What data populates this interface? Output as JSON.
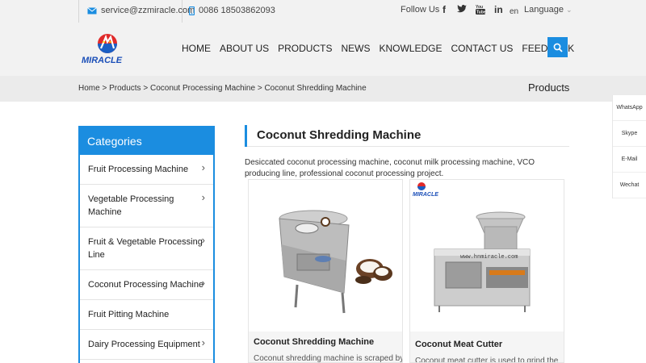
{
  "topbar": {
    "email": "service@zzmiracle.com",
    "phone": "0086 18503862093",
    "follow_label": "Follow Us",
    "social_icons": [
      "facebook-icon",
      "twitter-icon",
      "youtube-icon",
      "linkedin-icon"
    ],
    "lang_code": "en",
    "language_label": "Language"
  },
  "logo": {
    "text": "MIRACLE"
  },
  "nav": {
    "items": [
      "HOME",
      "ABOUT US",
      "PRODUCTS",
      "NEWS",
      "KNOWLEDGE",
      "CONTACT US",
      "FEEDBACK"
    ]
  },
  "breadcrumb": {
    "items": [
      "Home",
      "Products",
      "Coconut Processing Machine",
      "Coconut Shredding Machine"
    ],
    "separator": ">",
    "section_title": "Products"
  },
  "sidebar": {
    "heading": "Categories",
    "items": [
      {
        "label": "Fruit Processing Machine",
        "has_arrow": true
      },
      {
        "label": "Vegetable Processing Machine",
        "has_arrow": true
      },
      {
        "label": "Fruit & Vegetable Processing Line",
        "has_arrow": true
      },
      {
        "label": "Coconut Processing Machine",
        "has_arrow": true
      },
      {
        "label": "Fruit Pitting Machine",
        "has_arrow": false
      },
      {
        "label": "Dairy Processing Equipment",
        "has_arrow": true
      }
    ]
  },
  "main": {
    "title": "Coconut Shredding Machine",
    "intro": "Desiccated coconut processing machine, coconut milk processing machine, VCO producing line, professional coconut processing project.",
    "products": [
      {
        "title": "Coconut Shredding Machine",
        "desc": "Coconut shredding machine is scraped by"
      },
      {
        "title": "Coconut Meat Cutter",
        "desc": "Coconut meat cutter is used to grind the",
        "watermark": "www.hnmiracle.com",
        "badge": "MIRACLE"
      }
    ]
  },
  "float_bar": {
    "items": [
      "WhatsApp",
      "Skype",
      "E-Mail",
      "Wechat"
    ]
  },
  "colors": {
    "accent": "#1b8de0",
    "topbar_bg": "#f2f2f2",
    "crumb_bg": "#ebebeb"
  }
}
